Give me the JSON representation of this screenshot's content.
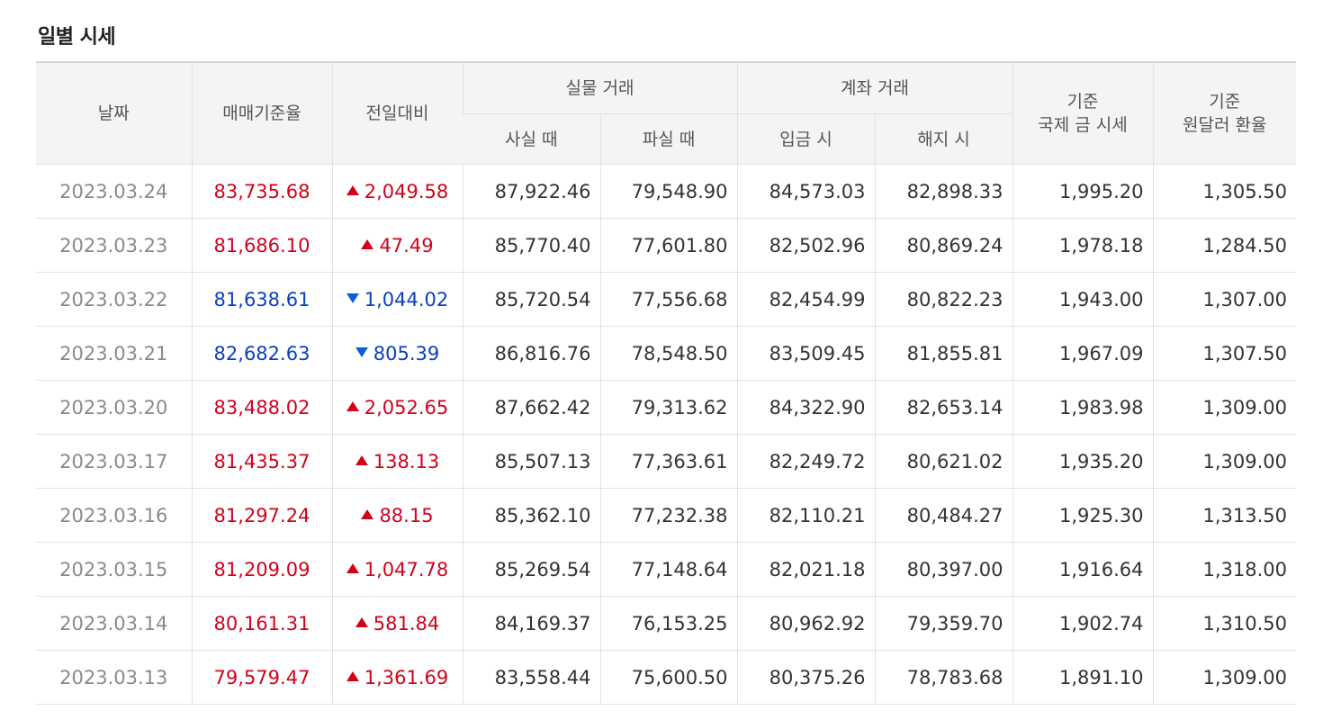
{
  "title": "일별 시세",
  "headers": {
    "date": "날짜",
    "base_rate": "매매기준율",
    "change": "전일대비",
    "physical": "실물 거래",
    "physical_buy": "사실 때",
    "physical_sell": "파실 때",
    "account": "계좌 거래",
    "account_deposit": "입금 시",
    "account_close": "해지 시",
    "intl_price_line1": "기준",
    "intl_price_line2": "국제 금 시세",
    "fx_line1": "기준",
    "fx_line2": "원달러 환율"
  },
  "rows": [
    {
      "date": "2023.03.24",
      "rate": "83,735.68",
      "dir": "up",
      "change": "2,049.58",
      "buy": "87,922.46",
      "sell": "79,548.90",
      "deposit": "84,573.03",
      "close": "82,898.33",
      "intl": "1,995.20",
      "fx": "1,305.50"
    },
    {
      "date": "2023.03.23",
      "rate": "81,686.10",
      "dir": "up",
      "change": "47.49",
      "buy": "85,770.40",
      "sell": "77,601.80",
      "deposit": "82,502.96",
      "close": "80,869.24",
      "intl": "1,978.18",
      "fx": "1,284.50"
    },
    {
      "date": "2023.03.22",
      "rate": "81,638.61",
      "dir": "down",
      "change": "1,044.02",
      "buy": "85,720.54",
      "sell": "77,556.68",
      "deposit": "82,454.99",
      "close": "80,822.23",
      "intl": "1,943.00",
      "fx": "1,307.00"
    },
    {
      "date": "2023.03.21",
      "rate": "82,682.63",
      "dir": "down",
      "change": "805.39",
      "buy": "86,816.76",
      "sell": "78,548.50",
      "deposit": "83,509.45",
      "close": "81,855.81",
      "intl": "1,967.09",
      "fx": "1,307.50"
    },
    {
      "date": "2023.03.20",
      "rate": "83,488.02",
      "dir": "up",
      "change": "2,052.65",
      "buy": "87,662.42",
      "sell": "79,313.62",
      "deposit": "84,322.90",
      "close": "82,653.14",
      "intl": "1,983.98",
      "fx": "1,309.00"
    },
    {
      "date": "2023.03.17",
      "rate": "81,435.37",
      "dir": "up",
      "change": "138.13",
      "buy": "85,507.13",
      "sell": "77,363.61",
      "deposit": "82,249.72",
      "close": "80,621.02",
      "intl": "1,935.20",
      "fx": "1,309.00"
    },
    {
      "date": "2023.03.16",
      "rate": "81,297.24",
      "dir": "up",
      "change": "88.15",
      "buy": "85,362.10",
      "sell": "77,232.38",
      "deposit": "82,110.21",
      "close": "80,484.27",
      "intl": "1,925.30",
      "fx": "1,313.50"
    },
    {
      "date": "2023.03.15",
      "rate": "81,209.09",
      "dir": "up",
      "change": "1,047.78",
      "buy": "85,269.54",
      "sell": "77,148.64",
      "deposit": "82,021.18",
      "close": "80,397.00",
      "intl": "1,916.64",
      "fx": "1,318.00"
    },
    {
      "date": "2023.03.14",
      "rate": "80,161.31",
      "dir": "up",
      "change": "581.84",
      "buy": "84,169.37",
      "sell": "76,153.25",
      "deposit": "80,962.92",
      "close": "79,359.70",
      "intl": "1,902.74",
      "fx": "1,310.50"
    },
    {
      "date": "2023.03.13",
      "rate": "79,579.47",
      "dir": "up",
      "change": "1,361.69",
      "buy": "83,558.44",
      "sell": "75,600.50",
      "deposit": "80,375.26",
      "close": "78,783.68",
      "intl": "1,891.10",
      "fx": "1,309.00"
    }
  ],
  "icons": {
    "up": "triangle-up-icon",
    "down": "triangle-down-icon"
  },
  "colors": {
    "up": "#d0021b",
    "down": "#0b3fbf",
    "date": "#8a8a8a",
    "header_bg": "#f4f4f4"
  }
}
